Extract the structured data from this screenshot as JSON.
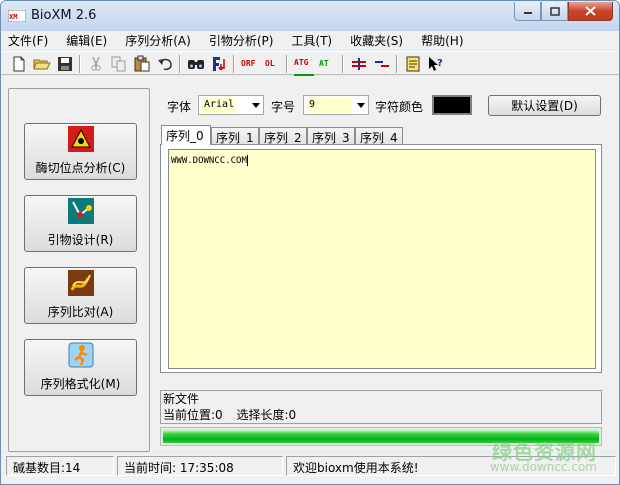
{
  "window": {
    "title": "BioXM 2.6"
  },
  "menu": [
    "文件(F)",
    "编辑(E)",
    "序列分析(A)",
    "引物分析(P)",
    "工具(T)",
    "收藏夹(S)",
    "帮助(H)"
  ],
  "toolbar": {
    "icons": [
      "new-file-icon",
      "open-folder-icon",
      "save-icon",
      "cut-icon",
      "copy-icon",
      "paste-icon",
      "undo-icon",
      "find-icon",
      "find-replace-icon",
      "orf-icon",
      "oligo-icon",
      "atg-icon",
      "at-icon",
      "align-icon",
      "compare-icon",
      "notes-icon",
      "help-pointer-icon"
    ],
    "orf_label": "ORF",
    "oligo_label": "OL",
    "atg_label": "ATG",
    "at_label": "AT"
  },
  "sidebar": {
    "buttons": [
      {
        "label": "酶切位点分析(C)",
        "icon": "enzyme-cut-icon"
      },
      {
        "label": "引物设计(R)",
        "icon": "primer-design-icon"
      },
      {
        "label": "序列比对(A)",
        "icon": "sequence-align-icon"
      },
      {
        "label": "序列格式化(M)",
        "icon": "format-runner-icon"
      }
    ]
  },
  "font_settings": {
    "font_label": "字体",
    "font_value": "Arial",
    "size_label": "字号",
    "size_value": "9",
    "color_label": "字符颜色",
    "text_color": "#000000",
    "default_button": "默认设置(D)"
  },
  "tabs": [
    "序列_0",
    "序列_1",
    "序列_2",
    "序列_3",
    "序列_4"
  ],
  "editor": {
    "content": "WWW.DOWNCC.COM",
    "background": "#ffffcc"
  },
  "info": {
    "file_status": "新文件",
    "position_label": "当前位置:0",
    "selection_label": "选择长度:0"
  },
  "progress": {
    "fraction": 1.0,
    "color": "#06b025"
  },
  "statusbar": {
    "base_count": "碱基数目:14",
    "current_time": "当前时间: 17:35:08",
    "welcome": "欢迎bioxm使用本系统!"
  },
  "watermark": {
    "text": "绿色资源网",
    "url": "www.downcc.com"
  }
}
